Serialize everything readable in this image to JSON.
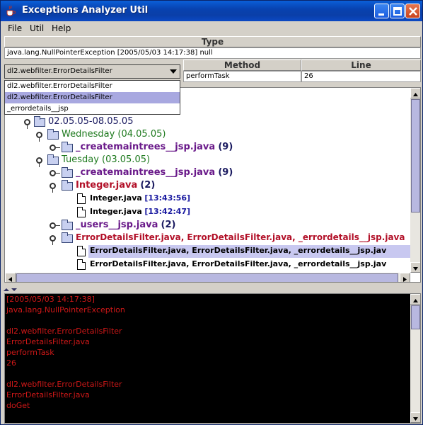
{
  "window": {
    "title": "Exceptions Analyzer Util"
  },
  "menu": {
    "file": "File",
    "util": "Util",
    "help": "Help"
  },
  "type_panel": {
    "header": "Type",
    "value": "java.lang.NullPointerException [2005/05/03 14:17:38] null"
  },
  "class_combo": {
    "selected": "dl2.webfilter.ErrorDetailsFilter",
    "options": [
      "dl2.webfilter.ErrorDetailsFilter",
      "dl2.webfilter.ErrorDetailsFilter",
      "_errordetails__jsp"
    ]
  },
  "method_table": {
    "method_header": "Method",
    "line_header": "Line",
    "method_value": "performTask",
    "line_value": "26"
  },
  "tree": {
    "range": "02.05.05-08.05.05",
    "wednesday": "Wednesday (04.05.05)",
    "wed_createmaintrees": "_createmaintrees__jsp.java",
    "wed_createmaintrees_count": "(9)",
    "tuesday": "Tuesday (03.05.05)",
    "tue_createmaintrees": "_createmaintrees__jsp.java",
    "tue_createmaintrees_count": "(9)",
    "integer": "Integer.java",
    "integer_count": "(2)",
    "int1_name": "Integer.java",
    "int1_time": "[13:43:56]",
    "int2_name": "Integer.java",
    "int2_time": "[13:42:47]",
    "users": "_users__jsp.java",
    "users_count": "(2)",
    "errordetails": "ErrorDetailsFilter.java, ErrorDetailsFilter.java, _errordetails__jsp.java",
    "err1": "ErrorDetailsFilter.java, ErrorDetailsFilter.java, _errordetails__jsp.jav",
    "err2": "ErrorDetailsFilter.java, ErrorDetailsFilter.java, _errordetails__jsp.jav"
  },
  "console": {
    "lines": [
      "[2005/05/03 14:17:38]",
      "java.lang.NullPointerException",
      "",
      "dl2.webfilter.ErrorDetailsFilter",
      "ErrorDetailsFilter.java",
      "performTask",
      "26",
      "",
      "dl2.webfilter.ErrorDetailsFilter",
      "ErrorDetailsFilter.java",
      "doGet"
    ]
  },
  "colors": {
    "titlebar": "#0842b0",
    "console_bg": "#000000",
    "console_text": "#d01818",
    "selection": "#a8a8e0"
  }
}
